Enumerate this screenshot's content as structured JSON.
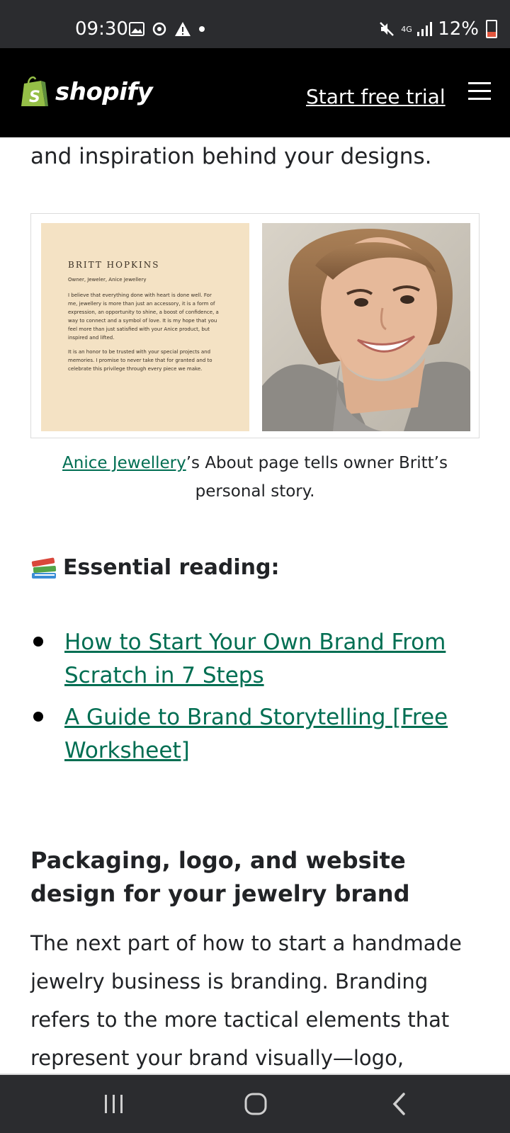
{
  "status_bar": {
    "time": "09:30",
    "battery": "12%",
    "network": "4G"
  },
  "header": {
    "logo_text": "shopify",
    "cta_label": "Start free trial",
    "brand_color": "#95bf47"
  },
  "article": {
    "lead_text": "and inspiration behind your designs.",
    "figure": {
      "card_name": "BRITT HOPKINS",
      "card_role": "Owner, Jeweler, Anice Jewellery",
      "card_paragraph_1": "I believe that everything done with heart is done well. For me, jewellery is more than just an accessory, it is a form of expression, an opportunity to shine, a boost of confidence, a way to connect and a symbol of love. It is my hope that you feel more than just satisfied with your Anice product, but inspired and lifted.",
      "card_paragraph_2": "It is an honor to be trusted with your special projects and memories. I promise to never take that for granted and to celebrate this privilege through every piece we make.",
      "caption_link": "Anice Jewellery",
      "caption_rest": "’s About page tells owner Britt’s personal story."
    },
    "essential_heading": "Essential reading:",
    "reading_links": [
      "How to Start Your Own Brand From Scratch in 7 Steps",
      "A Guide to Brand Storytelling [Free Worksheet]"
    ],
    "section_heading": "Packaging, logo, and website design for your jewelry brand",
    "body_paragraph": "The next part of how to start a handmade jewelry business is branding. Branding refers to the more tactical elements that represent your brand visually—logo,"
  },
  "colors": {
    "link": "#006e52",
    "header_bg": "#000000",
    "card_bg": "#f4e2c4"
  },
  "nav_icons": [
    "recents-icon",
    "home-icon",
    "back-icon"
  ]
}
